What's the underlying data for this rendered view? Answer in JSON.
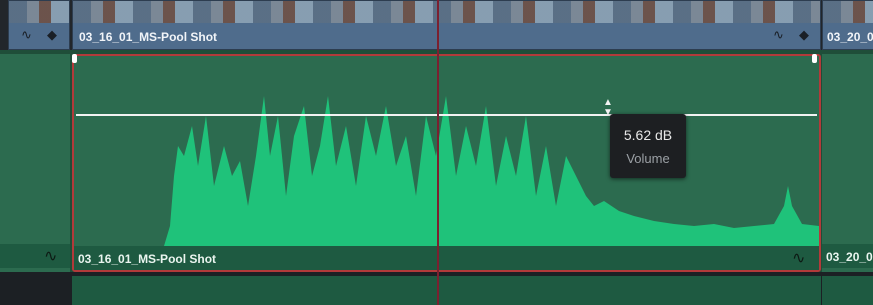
{
  "video_track": {
    "clip_main_label": "03_16_01_MS-Pool Shot",
    "clip_right_label": "03_20_0"
  },
  "audio_track": {
    "clip_main_label": "03_16_01_MS-Pool Shot",
    "clip_right_label": "03_20_0"
  },
  "volume_tooltip": {
    "value": "5.62 dB",
    "label": "Volume"
  },
  "colors": {
    "waveform": "#1fc27a",
    "clip_selected_border": "#b23a3a",
    "playhead": "#7b2030",
    "video_clip": "#4f6c8c"
  },
  "icons": [
    "audio-curve-icon",
    "keyframe-icon",
    "volume-adjust-icon"
  ]
}
